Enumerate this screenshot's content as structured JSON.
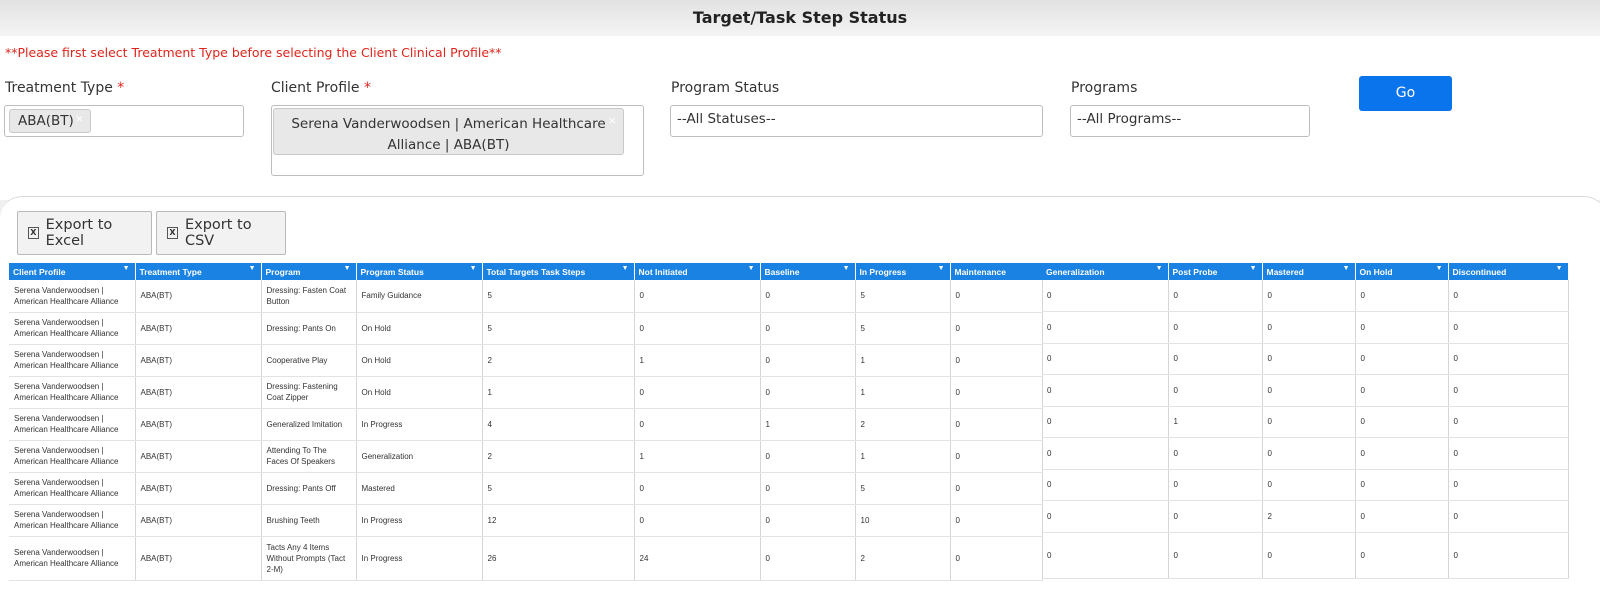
{
  "page_title": "Target/Task Step Status",
  "warning": "**Please first select Treatment Type before selecting the Client Clinical Profile**",
  "filters": {
    "treatment_type": {
      "label": "Treatment Type",
      "required_mark": "*",
      "chip": "ABA(BT)"
    },
    "client_profile": {
      "label": "Client Profile",
      "required_mark": "*",
      "chip_line1": "Serena Vanderwoodsen | American Healthcare",
      "chip_line2": "Alliance | ABA(BT)"
    },
    "program_status": {
      "label": "Program Status",
      "value": "--All Statuses--"
    },
    "programs": {
      "label": "Programs",
      "value": "--All Programs--"
    },
    "go_label": "Go"
  },
  "export": {
    "excel_label": "Export to Excel",
    "csv_label": "Export to CSV"
  },
  "colors": {
    "accent": "#1a82e2",
    "go_button": "#0a74ec",
    "required": "#e0241b"
  },
  "table": {
    "left_columns": [
      "Client Profile",
      "Treatment Type",
      "Program",
      "Program Status",
      "Total Targets Task Steps",
      "Not Initiated",
      "Baseline",
      "In Progress",
      "Maintenance"
    ],
    "right_columns": [
      "Generalization",
      "Post Probe",
      "Mastered",
      "On Hold",
      "Discontinued"
    ],
    "rows": [
      {
        "client1": "Serena Vanderwoodsen |",
        "client2": "American Healthcare Alliance",
        "treatment": "ABA(BT)",
        "program": "Dressing: Fasten Coat Button",
        "status": "Family Guidance",
        "total": "5",
        "not_initiated": "0",
        "baseline": "0",
        "in_progress": "5",
        "maintenance": "0",
        "generalization": "0",
        "post_probe": "0",
        "mastered": "0",
        "on_hold": "0",
        "discontinued": "0"
      },
      {
        "client1": "Serena Vanderwoodsen |",
        "client2": "American Healthcare Alliance",
        "treatment": "ABA(BT)",
        "program": "Dressing: Pants On",
        "status": "On Hold",
        "total": "5",
        "not_initiated": "0",
        "baseline": "0",
        "in_progress": "5",
        "maintenance": "0",
        "generalization": "0",
        "post_probe": "0",
        "mastered": "0",
        "on_hold": "0",
        "discontinued": "0"
      },
      {
        "client1": "Serena Vanderwoodsen |",
        "client2": "American Healthcare Alliance",
        "treatment": "ABA(BT)",
        "program": "Cooperative Play",
        "status": "On Hold",
        "total": "2",
        "not_initiated": "1",
        "baseline": "0",
        "in_progress": "1",
        "maintenance": "0",
        "generalization": "0",
        "post_probe": "0",
        "mastered": "0",
        "on_hold": "0",
        "discontinued": "0"
      },
      {
        "client1": "Serena Vanderwoodsen |",
        "client2": "American Healthcare Alliance",
        "treatment": "ABA(BT)",
        "program": "Dressing: Fastening Coat Zipper",
        "status": "On Hold",
        "total": "1",
        "not_initiated": "0",
        "baseline": "0",
        "in_progress": "1",
        "maintenance": "0",
        "generalization": "0",
        "post_probe": "0",
        "mastered": "0",
        "on_hold": "0",
        "discontinued": "0"
      },
      {
        "client1": "Serena Vanderwoodsen |",
        "client2": "American Healthcare Alliance",
        "treatment": "ABA(BT)",
        "program": "Generalized Imitation",
        "status": "In Progress",
        "total": "4",
        "not_initiated": "0",
        "baseline": "1",
        "in_progress": "2",
        "maintenance": "0",
        "generalization": "0",
        "post_probe": "1",
        "mastered": "0",
        "on_hold": "0",
        "discontinued": "0"
      },
      {
        "client1": "Serena Vanderwoodsen |",
        "client2": "American Healthcare Alliance",
        "treatment": "ABA(BT)",
        "program": "Attending To The Faces Of Speakers",
        "status": "Generalization",
        "total": "2",
        "not_initiated": "1",
        "baseline": "0",
        "in_progress": "1",
        "maintenance": "0",
        "generalization": "0",
        "post_probe": "0",
        "mastered": "0",
        "on_hold": "0",
        "discontinued": "0"
      },
      {
        "client1": "Serena Vanderwoodsen |",
        "client2": "American Healthcare Alliance",
        "treatment": "ABA(BT)",
        "program": "Dressing: Pants Off",
        "status": "Mastered",
        "total": "5",
        "not_initiated": "0",
        "baseline": "0",
        "in_progress": "5",
        "maintenance": "0",
        "generalization": "0",
        "post_probe": "0",
        "mastered": "0",
        "on_hold": "0",
        "discontinued": "0"
      },
      {
        "client1": "Serena Vanderwoodsen |",
        "client2": "American Healthcare Alliance",
        "treatment": "ABA(BT)",
        "program": "Brushing Teeth",
        "status": "In Progress",
        "total": "12",
        "not_initiated": "0",
        "baseline": "0",
        "in_progress": "10",
        "maintenance": "0",
        "generalization": "0",
        "post_probe": "0",
        "mastered": "2",
        "on_hold": "0",
        "discontinued": "0"
      },
      {
        "client1": "Serena Vanderwoodsen |",
        "client2": "American Healthcare Alliance",
        "treatment": "ABA(BT)",
        "program": "Tacts Any 4 Items Without Prompts (Tact 2-M)",
        "status": "In Progress",
        "total": "26",
        "not_initiated": "24",
        "baseline": "0",
        "in_progress": "2",
        "maintenance": "0",
        "generalization": "0",
        "post_probe": "0",
        "mastered": "0",
        "on_hold": "0",
        "discontinued": "0"
      }
    ]
  }
}
